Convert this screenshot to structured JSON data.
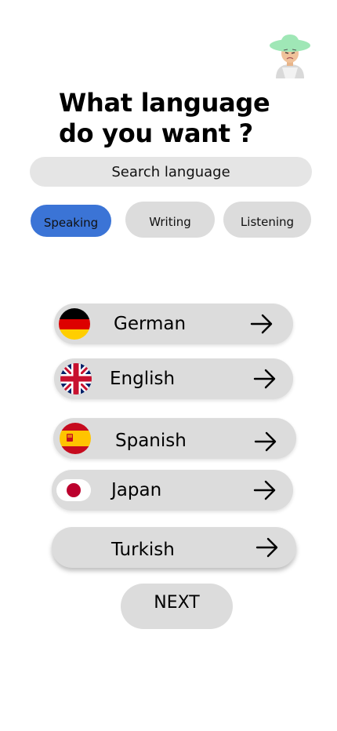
{
  "header": {
    "avatar_icon": "farmer-avatar-icon",
    "title": "What language do you want ?"
  },
  "search": {
    "placeholder": "Search language"
  },
  "modes": [
    {
      "label": "Speaking",
      "active": true
    },
    {
      "label": "Writing",
      "active": false
    },
    {
      "label": "Listening",
      "active": false
    }
  ],
  "languages": [
    {
      "name": "German",
      "flag_icon": "germany-flag-icon",
      "arrow_icon": "arrow-right-icon"
    },
    {
      "name": "English",
      "flag_icon": "uk-flag-icon",
      "arrow_icon": "arrow-right-icon"
    },
    {
      "name": "Spanish",
      "flag_icon": "spain-flag-icon",
      "arrow_icon": "arrow-right-icon"
    },
    {
      "name": "Japan",
      "flag_icon": "japan-flag-icon",
      "arrow_icon": "arrow-right-icon"
    },
    {
      "name": "Turkish",
      "flag_icon": "",
      "arrow_icon": "arrow-right-icon"
    }
  ],
  "next": {
    "label": "NEXT"
  },
  "colors": {
    "accent": "#3b74d6",
    "pill_bg": "#dcdcdc",
    "search_bg": "#e5e5e5"
  }
}
